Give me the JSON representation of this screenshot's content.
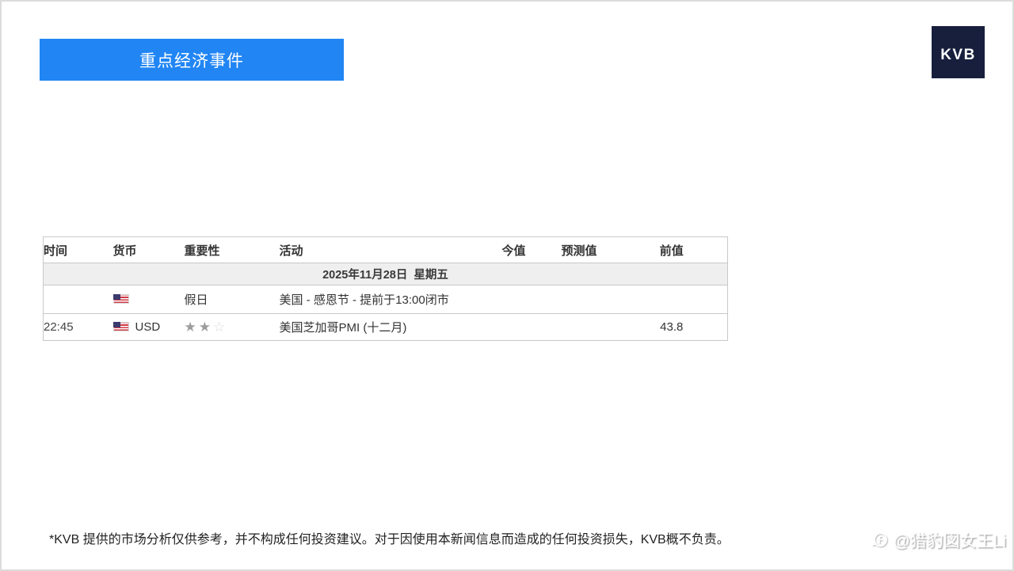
{
  "page": {
    "title_button": "重点经济事件",
    "logo_text": "KVB"
  },
  "colors": {
    "banner_blue": "#2186F4",
    "logo_navy": "#171F3D",
    "table_border": "#c8c8c8",
    "date_row_bg": "#efefef",
    "star_filled": "#9c9c9c",
    "star_empty": "#d9d9d9"
  },
  "icons": {
    "star_filled": "★",
    "star_empty": "☆",
    "flag": "us-flag-icon"
  },
  "table": {
    "headers": {
      "time": "时间",
      "currency": "货币",
      "importance": "重要性",
      "activity": "活动",
      "actual": "今值",
      "forecast": "预测值",
      "previous": "前值"
    },
    "date_row": "2025年11月28日  星期五",
    "rows": [
      {
        "time": "",
        "currency": "",
        "flag": "us-flag-icon",
        "importance": "假日",
        "activity": "美国 - 感恩节 - 提前于13:00闭市",
        "actual": "",
        "forecast": "",
        "previous": ""
      },
      {
        "time": "22:45",
        "currency": "USD",
        "flag": "us-flag-icon",
        "importance_stars_filled": 2,
        "importance_stars_total": 3,
        "activity": "美国芝加哥PMI (十二月)",
        "actual": "",
        "forecast": "",
        "previous": "43.8"
      }
    ]
  },
  "footer": {
    "disclaimer": "*KVB 提供的市场分析仅供参考，并不构成任何投资建议。对于因使用本新闻信息而造成的任何投资损失，KVB概不负责。",
    "watermark": "@猎豹図女王Li"
  }
}
